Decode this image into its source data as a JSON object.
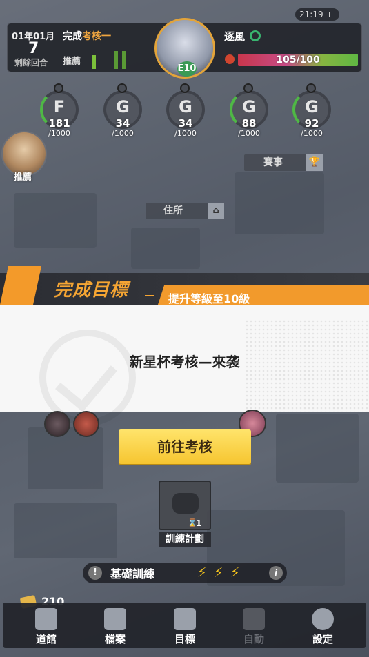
{
  "status_bar": {
    "time": "21:19"
  },
  "hud": {
    "date": "01年01月",
    "days_remaining": "7",
    "days_remaining_label": "剩餘回合",
    "task_prefix": "完成",
    "task_highlight": "考核一",
    "recommend_label": "推薦",
    "level_badge": "E10",
    "character_name": "逐風",
    "hp_value": "105/100",
    "hp_fraction": 1.0
  },
  "stats": [
    {
      "grade": "F",
      "value": "181",
      "max": "/1000"
    },
    {
      "grade": "G",
      "value": "34",
      "max": "/1000"
    },
    {
      "grade": "G",
      "value": "34",
      "max": "/1000"
    },
    {
      "grade": "G",
      "value": "88",
      "max": "/1000"
    },
    {
      "grade": "G",
      "value": "92",
      "max": "/1000"
    }
  ],
  "advisor_label": "推薦",
  "map_tags": {
    "event": "賽事",
    "residence": "住所"
  },
  "goal_banner": {
    "title": "完成目標",
    "subtitle": "提升等級至10級",
    "goal_text": "新星杯考核—來袭"
  },
  "go_button": "前往考核",
  "training": {
    "label": "訓練計劃",
    "hours": "1"
  },
  "basic_training": {
    "label": "基礎訓練",
    "bolts": [
      "⚡",
      "⚡",
      "⚡"
    ]
  },
  "currency": "210",
  "bottom_nav": [
    {
      "label": "道館",
      "icon": "gym-icon",
      "enabled": true
    },
    {
      "label": "檔案",
      "icon": "file-icon",
      "enabled": true
    },
    {
      "label": "目標",
      "icon": "goal-checklist-icon",
      "enabled": true
    },
    {
      "label": "自動",
      "icon": "auto-lock-icon",
      "enabled": false
    },
    {
      "label": "設定",
      "icon": "gear-icon",
      "enabled": true
    }
  ],
  "colors": {
    "accent_orange": "#f29a2c",
    "button_yellow": "#f6c530",
    "grade_green": "#4fb845"
  }
}
